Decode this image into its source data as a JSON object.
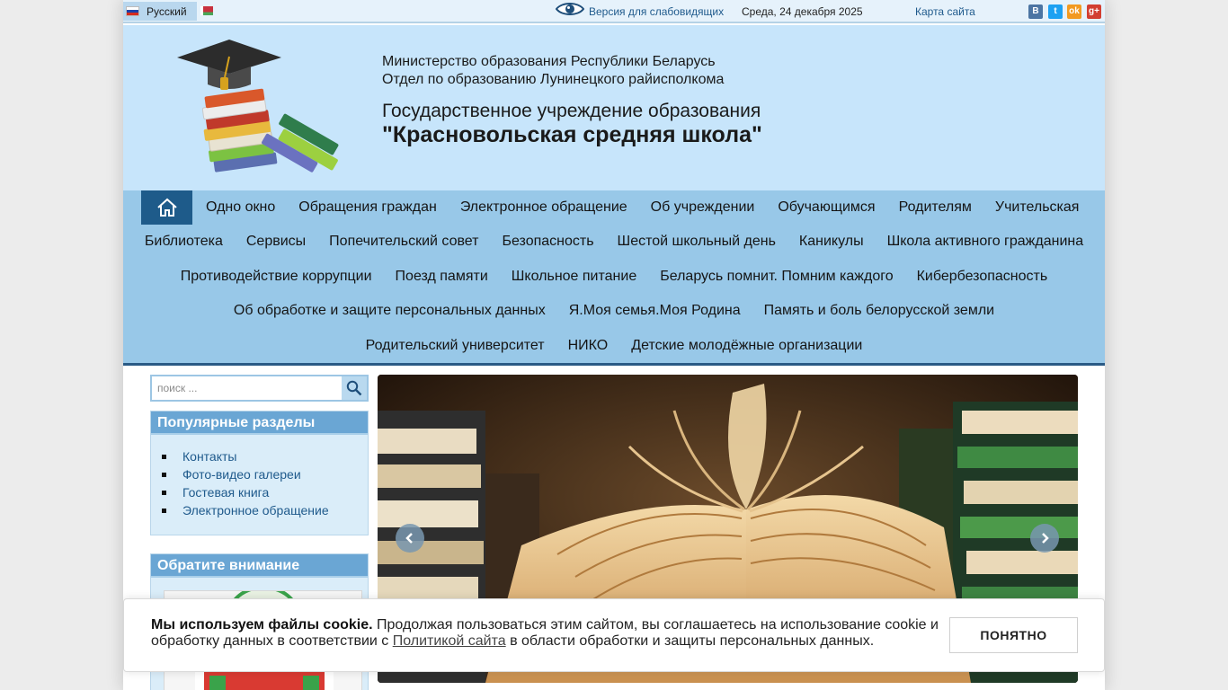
{
  "topbar": {
    "language_selected": "Русский",
    "vision_link": "Версия для слабовидящих",
    "date": "Среда, 24 декабря 2025",
    "sitemap_link": "Карта сайта",
    "social": {
      "vk": "В",
      "twitter": "t",
      "ok": "ok",
      "gplus": "g+"
    }
  },
  "header": {
    "ministry": "Министерство образования Республики Беларусь",
    "department": "Отдел по образованию Лунинецкого райисполкома",
    "institution_type": "Государственное учреждение образования",
    "school_name": "\"Красновольская средняя школа\""
  },
  "nav": {
    "row1": [
      "Одно окно",
      "Обращения граждан",
      "Электронное обращение",
      "Об учреждении",
      "Обучающимся",
      "Родителям",
      "Учительская"
    ],
    "row2": [
      "Библиотека",
      "Сервисы",
      "Попечительский совет",
      "Безопасность",
      "Шестой школьный день",
      "Каникулы",
      "Школа активного гражданина"
    ],
    "row3": [
      "Противодействие коррупции",
      "Поезд памяти",
      "Школьное питание",
      "Беларусь помнит. Помним каждого",
      "Кибербезопасность"
    ],
    "row4": [
      "Об обработке и защите персональных данных",
      "Я.Моя семья.Моя Родина",
      "Память и боль белорусской земли"
    ],
    "row5": [
      "Родительский университет",
      "НИКО",
      "Детские молодёжные организации"
    ]
  },
  "search": {
    "placeholder": "поиск ..."
  },
  "popular": {
    "title": "Популярные разделы",
    "items": [
      "Контакты",
      "Фото-видео галереи",
      "Гостевая книга",
      "Электронное обращение"
    ]
  },
  "attention": {
    "title": "Обратите внимание"
  },
  "cookie": {
    "bold": "Мы используем файлы cookie.",
    "text1": " Продолжая пользоваться этим сайтом, вы соглашаетесь на использование cookie и обработку данных в соответствии с ",
    "link": "Политикой сайта",
    "text2": " в области обработки и защиты персональных данных.",
    "button": "ПОНЯТНО"
  },
  "colors": {
    "header_bg": "#c7e5fb",
    "nav_bg": "#98c8e8",
    "home_btn": "#1e5b8a",
    "panel_title": "#6aa6d4",
    "link": "#1f5a8c"
  }
}
